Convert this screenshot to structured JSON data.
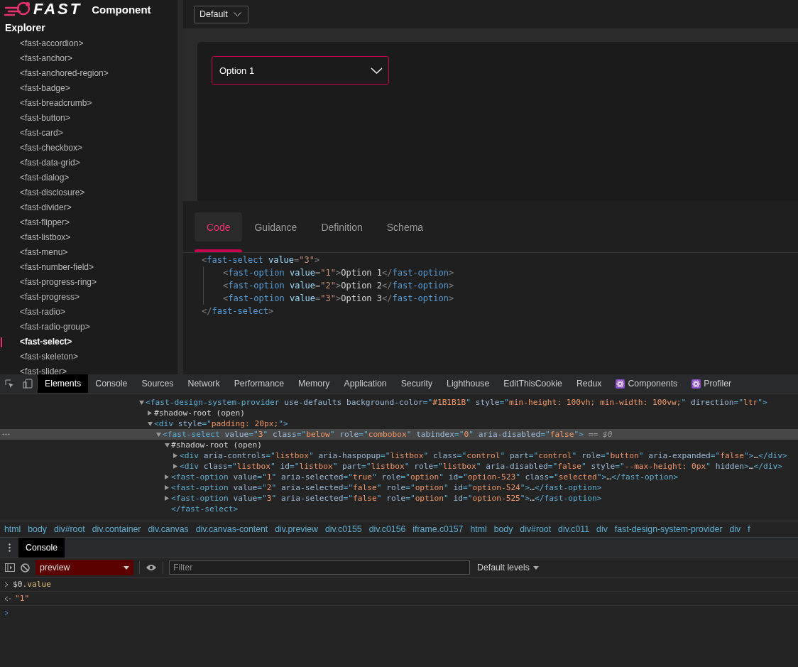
{
  "header": {
    "logo_text": "FAST",
    "title": "Component"
  },
  "sidebar": {
    "title": "Explorer",
    "items": [
      {
        "label": "<fast-accordion>",
        "selected": false
      },
      {
        "label": "<fast-anchor>",
        "selected": false
      },
      {
        "label": "<fast-anchored-region>",
        "selected": false
      },
      {
        "label": "<fast-badge>",
        "selected": false
      },
      {
        "label": "<fast-breadcrumb>",
        "selected": false
      },
      {
        "label": "<fast-button>",
        "selected": false
      },
      {
        "label": "<fast-card>",
        "selected": false
      },
      {
        "label": "<fast-checkbox>",
        "selected": false
      },
      {
        "label": "<fast-data-grid>",
        "selected": false
      },
      {
        "label": "<fast-dialog>",
        "selected": false
      },
      {
        "label": "<fast-disclosure>",
        "selected": false
      },
      {
        "label": "<fast-divider>",
        "selected": false
      },
      {
        "label": "<fast-flipper>",
        "selected": false
      },
      {
        "label": "<fast-listbox>",
        "selected": false
      },
      {
        "label": "<fast-menu>",
        "selected": false
      },
      {
        "label": "<fast-number-field>",
        "selected": false
      },
      {
        "label": "<fast-progress-ring>",
        "selected": false
      },
      {
        "label": "<fast-progress>",
        "selected": false
      },
      {
        "label": "<fast-radio>",
        "selected": false
      },
      {
        "label": "<fast-radio-group>",
        "selected": false
      },
      {
        "label": "<fast-select>",
        "selected": true
      },
      {
        "label": "<fast-skeleton>",
        "selected": false
      },
      {
        "label": "<fast-slider>",
        "selected": false
      }
    ]
  },
  "theme_dropdown": {
    "value": "Default"
  },
  "preview": {
    "select": {
      "value": "Option 1"
    }
  },
  "tabs": [
    {
      "label": "Code",
      "selected": true
    },
    {
      "label": "Guidance",
      "selected": false
    },
    {
      "label": "Definition",
      "selected": false
    },
    {
      "label": "Schema",
      "selected": false
    }
  ],
  "code": [
    {
      "tokens": [
        {
          "kind": "punct",
          "text": "<"
        },
        {
          "kind": "tag",
          "text": "fast-select"
        },
        {
          "kind": "attr",
          "text": " value"
        },
        {
          "kind": "punct",
          "text": "="
        },
        {
          "kind": "value",
          "text": "\"3\""
        },
        {
          "kind": "punct",
          "text": ">"
        }
      ],
      "children": [
        {
          "tokens": [
            {
              "kind": "punct",
              "text": "<"
            },
            {
              "kind": "tag",
              "text": "fast-option"
            },
            {
              "kind": "attr",
              "text": " value"
            },
            {
              "kind": "punct",
              "text": "="
            },
            {
              "kind": "value",
              "text": "\"1\""
            },
            {
              "kind": "punct",
              "text": ">"
            },
            {
              "kind": "text",
              "text": "Option 1"
            },
            {
              "kind": "punct",
              "text": "</"
            },
            {
              "kind": "tag",
              "text": "fast-option"
            },
            {
              "kind": "punct",
              "text": ">"
            }
          ]
        },
        {
          "tokens": [
            {
              "kind": "punct",
              "text": "<"
            },
            {
              "kind": "tag",
              "text": "fast-option"
            },
            {
              "kind": "attr",
              "text": " value"
            },
            {
              "kind": "punct",
              "text": "="
            },
            {
              "kind": "value",
              "text": "\"2\""
            },
            {
              "kind": "punct",
              "text": ">"
            },
            {
              "kind": "text",
              "text": "Option 2"
            },
            {
              "kind": "punct",
              "text": "</"
            },
            {
              "kind": "tag",
              "text": "fast-option"
            },
            {
              "kind": "punct",
              "text": ">"
            }
          ]
        },
        {
          "tokens": [
            {
              "kind": "punct",
              "text": "<"
            },
            {
              "kind": "tag",
              "text": "fast-option"
            },
            {
              "kind": "attr",
              "text": " value"
            },
            {
              "kind": "punct",
              "text": "="
            },
            {
              "kind": "value",
              "text": "\"3\""
            },
            {
              "kind": "punct",
              "text": ">"
            },
            {
              "kind": "text",
              "text": "Option 3"
            },
            {
              "kind": "punct",
              "text": "</"
            },
            {
              "kind": "tag",
              "text": "fast-option"
            },
            {
              "kind": "punct",
              "text": ">"
            }
          ]
        }
      ]
    },
    {
      "tokens": [
        {
          "kind": "punct",
          "text": "</"
        },
        {
          "kind": "tag",
          "text": "fast-select"
        },
        {
          "kind": "punct",
          "text": ">"
        }
      ]
    }
  ],
  "devtools": {
    "tabs": [
      {
        "label": "Elements",
        "selected": true
      },
      {
        "label": "Console",
        "selected": false
      },
      {
        "label": "Sources",
        "selected": false
      },
      {
        "label": "Network",
        "selected": false
      },
      {
        "label": "Performance",
        "selected": false
      },
      {
        "label": "Memory",
        "selected": false
      },
      {
        "label": "Application",
        "selected": false
      },
      {
        "label": "Security",
        "selected": false
      },
      {
        "label": "Lighthouse",
        "selected": false
      },
      {
        "label": "EditThisCookie",
        "selected": false
      },
      {
        "label": "Redux",
        "selected": false
      },
      {
        "label": "Components",
        "selected": false,
        "kind": "react"
      },
      {
        "label": "Profiler",
        "selected": false,
        "kind": "react"
      }
    ],
    "dom_tree": [
      {
        "expanded": true,
        "selected": false,
        "tokens": [
          {
            "kind": "tag",
            "text": "<fast-design-system-provider"
          },
          {
            "kind": "attr",
            "text": " use-defaults"
          },
          {
            "kind": "attr",
            "text": " background-color"
          },
          {
            "kind": "tag",
            "text": "=\""
          },
          {
            "kind": "value",
            "text": "#1B1B1B"
          },
          {
            "kind": "tag",
            "text": "\""
          },
          {
            "kind": "attr",
            "text": " style"
          },
          {
            "kind": "tag",
            "text": "=\""
          },
          {
            "kind": "value",
            "text": "min-height: 100vh; min-width: 100vw;"
          },
          {
            "kind": "tag",
            "text": "\""
          },
          {
            "kind": "attr",
            "text": " direction"
          },
          {
            "kind": "tag",
            "text": "=\""
          },
          {
            "kind": "value",
            "text": "ltr"
          },
          {
            "kind": "tag",
            "text": "\">"
          }
        ],
        "children": [
          {
            "expanded": false,
            "selected": false,
            "tokens": [
              {
                "kind": "text",
                "text": "#shadow-root (open)"
              }
            ]
          },
          {
            "expanded": true,
            "selected": false,
            "tokens": [
              {
                "kind": "tag",
                "text": "<div"
              },
              {
                "kind": "attr",
                "text": " style"
              },
              {
                "kind": "tag",
                "text": "=\""
              },
              {
                "kind": "value",
                "text": "padding: 20px;"
              },
              {
                "kind": "tag",
                "text": "\">"
              }
            ],
            "children": [
              {
                "expanded": true,
                "selected": true,
                "tokens": [
                  {
                    "kind": "tag",
                    "text": "<fast-select"
                  },
                  {
                    "kind": "attr",
                    "text": " value"
                  },
                  {
                    "kind": "tag",
                    "text": "=\""
                  },
                  {
                    "kind": "value",
                    "text": "3"
                  },
                  {
                    "kind": "tag",
                    "text": "\""
                  },
                  {
                    "kind": "attr",
                    "text": " class"
                  },
                  {
                    "kind": "tag",
                    "text": "=\""
                  },
                  {
                    "kind": "value",
                    "text": "below"
                  },
                  {
                    "kind": "tag",
                    "text": "\""
                  },
                  {
                    "kind": "attr",
                    "text": " role"
                  },
                  {
                    "kind": "tag",
                    "text": "=\""
                  },
                  {
                    "kind": "value",
                    "text": "combobox"
                  },
                  {
                    "kind": "tag",
                    "text": "\""
                  },
                  {
                    "kind": "attr",
                    "text": " tabindex"
                  },
                  {
                    "kind": "tag",
                    "text": "=\""
                  },
                  {
                    "kind": "value",
                    "text": "0"
                  },
                  {
                    "kind": "tag",
                    "text": "\""
                  },
                  {
                    "kind": "attr",
                    "text": " aria-disabled"
                  },
                  {
                    "kind": "tag",
                    "text": "=\""
                  },
                  {
                    "kind": "value",
                    "text": "false"
                  },
                  {
                    "kind": "tag",
                    "text": "\">"
                  },
                  {
                    "kind": "dim",
                    "text": " == $0"
                  }
                ],
                "children": [
                  {
                    "expanded": true,
                    "selected": false,
                    "tokens": [
                      {
                        "kind": "text",
                        "text": "#shadow-root (open)"
                      }
                    ],
                    "children": [
                      {
                        "expanded": false,
                        "selected": false,
                        "tokens": [
                          {
                            "kind": "tag",
                            "text": "<div"
                          },
                          {
                            "kind": "attr",
                            "text": " aria-controls"
                          },
                          {
                            "kind": "tag",
                            "text": "=\""
                          },
                          {
                            "kind": "value",
                            "text": "listbox"
                          },
                          {
                            "kind": "tag",
                            "text": "\""
                          },
                          {
                            "kind": "attr",
                            "text": " aria-haspopup"
                          },
                          {
                            "kind": "tag",
                            "text": "=\""
                          },
                          {
                            "kind": "value",
                            "text": "listbox"
                          },
                          {
                            "kind": "tag",
                            "text": "\""
                          },
                          {
                            "kind": "attr",
                            "text": " class"
                          },
                          {
                            "kind": "tag",
                            "text": "=\""
                          },
                          {
                            "kind": "value",
                            "text": "control"
                          },
                          {
                            "kind": "tag",
                            "text": "\""
                          },
                          {
                            "kind": "attr",
                            "text": " part"
                          },
                          {
                            "kind": "tag",
                            "text": "=\""
                          },
                          {
                            "kind": "value",
                            "text": "control"
                          },
                          {
                            "kind": "tag",
                            "text": "\""
                          },
                          {
                            "kind": "attr",
                            "text": " role"
                          },
                          {
                            "kind": "tag",
                            "text": "=\""
                          },
                          {
                            "kind": "value",
                            "text": "button"
                          },
                          {
                            "kind": "tag",
                            "text": "\""
                          },
                          {
                            "kind": "attr",
                            "text": " aria-expanded"
                          },
                          {
                            "kind": "tag",
                            "text": "=\""
                          },
                          {
                            "kind": "value",
                            "text": "false"
                          },
                          {
                            "kind": "tag",
                            "text": "\">"
                          },
                          {
                            "kind": "text",
                            "text": "…"
                          },
                          {
                            "kind": "tag",
                            "text": "</div>"
                          }
                        ]
                      },
                      {
                        "expanded": false,
                        "selected": false,
                        "tokens": [
                          {
                            "kind": "tag",
                            "text": "<div"
                          },
                          {
                            "kind": "attr",
                            "text": " class"
                          },
                          {
                            "kind": "tag",
                            "text": "=\""
                          },
                          {
                            "kind": "value",
                            "text": "listbox"
                          },
                          {
                            "kind": "tag",
                            "text": "\""
                          },
                          {
                            "kind": "attr",
                            "text": " id"
                          },
                          {
                            "kind": "tag",
                            "text": "=\""
                          },
                          {
                            "kind": "value",
                            "text": "listbox"
                          },
                          {
                            "kind": "tag",
                            "text": "\""
                          },
                          {
                            "kind": "attr",
                            "text": " part"
                          },
                          {
                            "kind": "tag",
                            "text": "=\""
                          },
                          {
                            "kind": "value",
                            "text": "listbox"
                          },
                          {
                            "kind": "tag",
                            "text": "\""
                          },
                          {
                            "kind": "attr",
                            "text": " role"
                          },
                          {
                            "kind": "tag",
                            "text": "=\""
                          },
                          {
                            "kind": "value",
                            "text": "listbox"
                          },
                          {
                            "kind": "tag",
                            "text": "\""
                          },
                          {
                            "kind": "attr",
                            "text": " aria-disabled"
                          },
                          {
                            "kind": "tag",
                            "text": "=\""
                          },
                          {
                            "kind": "value",
                            "text": "false"
                          },
                          {
                            "kind": "tag",
                            "text": "\""
                          },
                          {
                            "kind": "attr",
                            "text": " style"
                          },
                          {
                            "kind": "tag",
                            "text": "=\""
                          },
                          {
                            "kind": "value",
                            "text": "--max-height: 0px"
                          },
                          {
                            "kind": "tag",
                            "text": "\""
                          },
                          {
                            "kind": "attr",
                            "text": " hidden"
                          },
                          {
                            "kind": "tag",
                            "text": ">"
                          },
                          {
                            "kind": "text",
                            "text": "…"
                          },
                          {
                            "kind": "tag",
                            "text": "</div>"
                          }
                        ]
                      }
                    ]
                  },
                  {
                    "expanded": false,
                    "selected": false,
                    "tokens": [
                      {
                        "kind": "tag",
                        "text": "<fast-option"
                      },
                      {
                        "kind": "attr",
                        "text": " value"
                      },
                      {
                        "kind": "tag",
                        "text": "=\""
                      },
                      {
                        "kind": "value",
                        "text": "1"
                      },
                      {
                        "kind": "tag",
                        "text": "\""
                      },
                      {
                        "kind": "attr",
                        "text": " aria-selected"
                      },
                      {
                        "kind": "tag",
                        "text": "=\""
                      },
                      {
                        "kind": "value",
                        "text": "true"
                      },
                      {
                        "kind": "tag",
                        "text": "\""
                      },
                      {
                        "kind": "attr",
                        "text": " role"
                      },
                      {
                        "kind": "tag",
                        "text": "=\""
                      },
                      {
                        "kind": "value",
                        "text": "option"
                      },
                      {
                        "kind": "tag",
                        "text": "\""
                      },
                      {
                        "kind": "attr",
                        "text": " id"
                      },
                      {
                        "kind": "tag",
                        "text": "=\""
                      },
                      {
                        "kind": "value",
                        "text": "option-523"
                      },
                      {
                        "kind": "tag",
                        "text": "\""
                      },
                      {
                        "kind": "attr",
                        "text": " class"
                      },
                      {
                        "kind": "tag",
                        "text": "=\""
                      },
                      {
                        "kind": "value",
                        "text": "selected"
                      },
                      {
                        "kind": "tag",
                        "text": "\">"
                      },
                      {
                        "kind": "text",
                        "text": "…"
                      },
                      {
                        "kind": "tag",
                        "text": "</fast-option>"
                      }
                    ]
                  },
                  {
                    "expanded": false,
                    "selected": false,
                    "tokens": [
                      {
                        "kind": "tag",
                        "text": "<fast-option"
                      },
                      {
                        "kind": "attr",
                        "text": " value"
                      },
                      {
                        "kind": "tag",
                        "text": "=\""
                      },
                      {
                        "kind": "value",
                        "text": "2"
                      },
                      {
                        "kind": "tag",
                        "text": "\""
                      },
                      {
                        "kind": "attr",
                        "text": " aria-selected"
                      },
                      {
                        "kind": "tag",
                        "text": "=\""
                      },
                      {
                        "kind": "value",
                        "text": "false"
                      },
                      {
                        "kind": "tag",
                        "text": "\""
                      },
                      {
                        "kind": "attr",
                        "text": " role"
                      },
                      {
                        "kind": "tag",
                        "text": "=\""
                      },
                      {
                        "kind": "value",
                        "text": "option"
                      },
                      {
                        "kind": "tag",
                        "text": "\""
                      },
                      {
                        "kind": "attr",
                        "text": " id"
                      },
                      {
                        "kind": "tag",
                        "text": "=\""
                      },
                      {
                        "kind": "value",
                        "text": "option-524"
                      },
                      {
                        "kind": "tag",
                        "text": "\">"
                      },
                      {
                        "kind": "text",
                        "text": "…"
                      },
                      {
                        "kind": "tag",
                        "text": "</fast-option>"
                      }
                    ]
                  },
                  {
                    "expanded": false,
                    "selected": false,
                    "tokens": [
                      {
                        "kind": "tag",
                        "text": "<fast-option"
                      },
                      {
                        "kind": "attr",
                        "text": " value"
                      },
                      {
                        "kind": "tag",
                        "text": "=\""
                      },
                      {
                        "kind": "value",
                        "text": "3"
                      },
                      {
                        "kind": "tag",
                        "text": "\""
                      },
                      {
                        "kind": "attr",
                        "text": " aria-selected"
                      },
                      {
                        "kind": "tag",
                        "text": "=\""
                      },
                      {
                        "kind": "value",
                        "text": "false"
                      },
                      {
                        "kind": "tag",
                        "text": "\""
                      },
                      {
                        "kind": "attr",
                        "text": " role"
                      },
                      {
                        "kind": "tag",
                        "text": "=\""
                      },
                      {
                        "kind": "value",
                        "text": "option"
                      },
                      {
                        "kind": "tag",
                        "text": "\""
                      },
                      {
                        "kind": "attr",
                        "text": " id"
                      },
                      {
                        "kind": "tag",
                        "text": "=\""
                      },
                      {
                        "kind": "value",
                        "text": "option-525"
                      },
                      {
                        "kind": "tag",
                        "text": "\">"
                      },
                      {
                        "kind": "text",
                        "text": "…"
                      },
                      {
                        "kind": "tag",
                        "text": "</fast-option>"
                      }
                    ]
                  },
                  {
                    "selected": false,
                    "tokens": [
                      {
                        "kind": "tag",
                        "text": "</fast-select>"
                      }
                    ]
                  }
                ]
              }
            ]
          }
        ]
      }
    ],
    "breadcrumbs": [
      "html",
      "body",
      "div#root",
      "div.container",
      "div.canvas",
      "div.canvas-content",
      "div.preview",
      "div.c0155",
      "div.c0156",
      "iframe.c0157",
      "html",
      "body",
      "div#root",
      "div.c011",
      "div",
      "fast-design-system-provider",
      "div",
      "f"
    ],
    "drawer_tabs": [
      {
        "label": "Console",
        "selected": true
      }
    ],
    "console": {
      "context": "preview",
      "filter_placeholder": "Filter",
      "levels": "Default levels",
      "entries": [
        {
          "kind": "input",
          "tokens": [
            {
              "kind": "text",
              "text": "$0"
            },
            {
              "kind": "prop",
              "text": ".value"
            }
          ]
        },
        {
          "kind": "output",
          "tokens": [
            {
              "kind": "value",
              "text": "\"1\""
            }
          ]
        },
        {
          "kind": "prompt"
        }
      ]
    }
  }
}
